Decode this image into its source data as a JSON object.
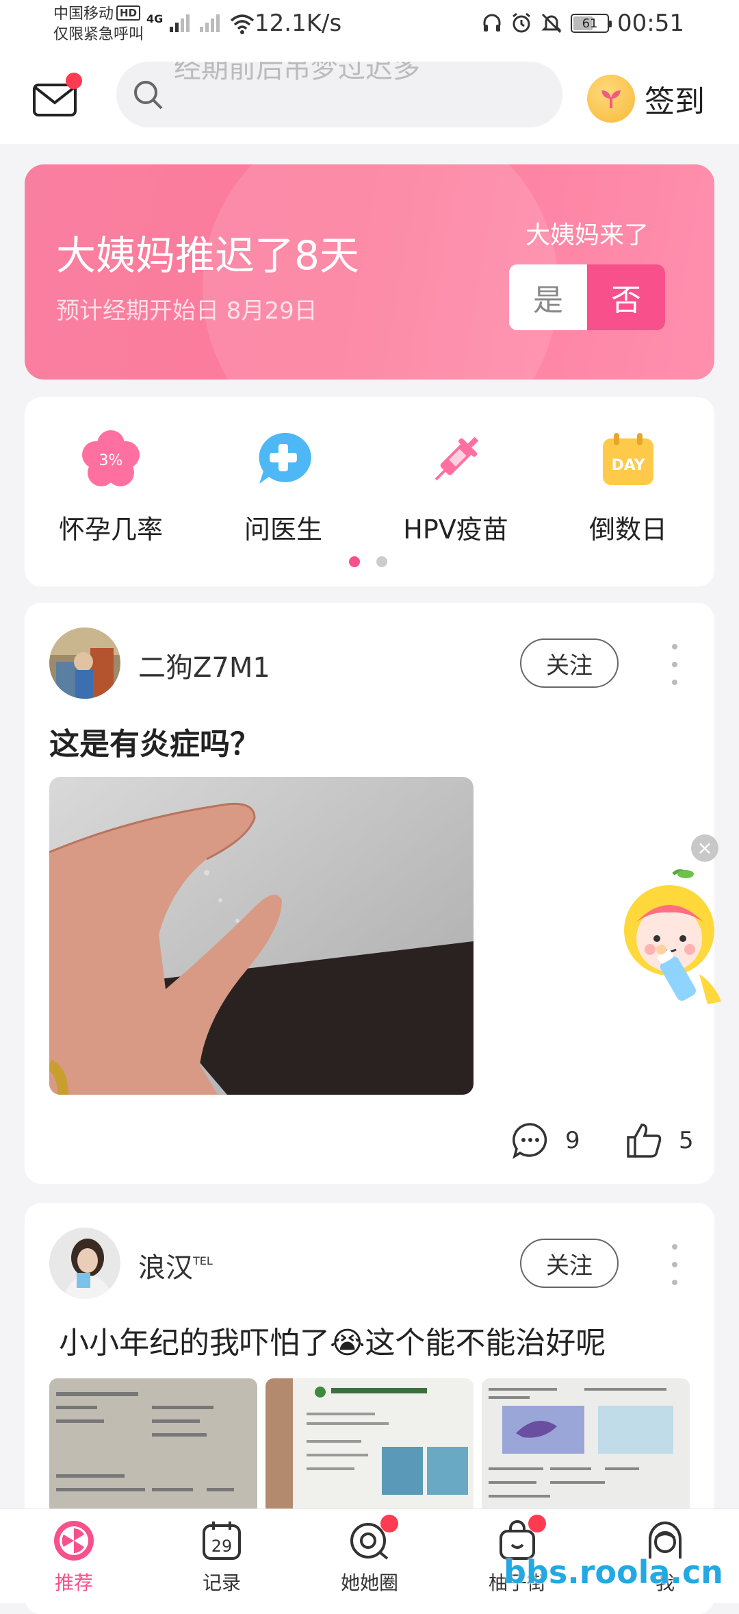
{
  "status_bar": {
    "carrier": "中国移动",
    "carrier_badge": "HD",
    "emergency": "仅限紧急呼叫",
    "network": "4G",
    "speed": "12.1K/s",
    "battery": "61",
    "battery_level": 0.61,
    "time": "00:51"
  },
  "header": {
    "search_placeholder": "经期前后吊梦过迟多",
    "checkin_label": "签到"
  },
  "period_card": {
    "title": "大姨妈推迟了8天",
    "subtitle": "预计经期开始日 8月29日",
    "question": "大姨妈来了",
    "yes": "是",
    "no": "否"
  },
  "tools": [
    {
      "label": "怀孕几率",
      "badge": "3%"
    },
    {
      "label": "问医生"
    },
    {
      "label": "HPV疫苗"
    },
    {
      "label": "倒数日",
      "badge": "DAY"
    }
  ],
  "posts": [
    {
      "username": "二狗Z7M1",
      "follow": "关注",
      "title": "这是有炎症吗？",
      "comments": "9",
      "likes": "5"
    },
    {
      "username": "浪汉",
      "username_sup": "TEL",
      "follow": "关注",
      "title": "小小年纪的我吓怕了😭这个能不能治好呢"
    }
  ],
  "tabbar": [
    {
      "label": "推荐",
      "active": true
    },
    {
      "label": "记录",
      "icon_text": "29"
    },
    {
      "label": "她她圈"
    },
    {
      "label": "柚子街"
    },
    {
      "label": "我"
    }
  ],
  "watermark": "bbs.roola.cn",
  "colors": {
    "accent": "#f7508a",
    "badge": "#ff3b52",
    "card_gradient_start": "#f97fa0",
    "card_gradient_end": "#ff8fae"
  }
}
